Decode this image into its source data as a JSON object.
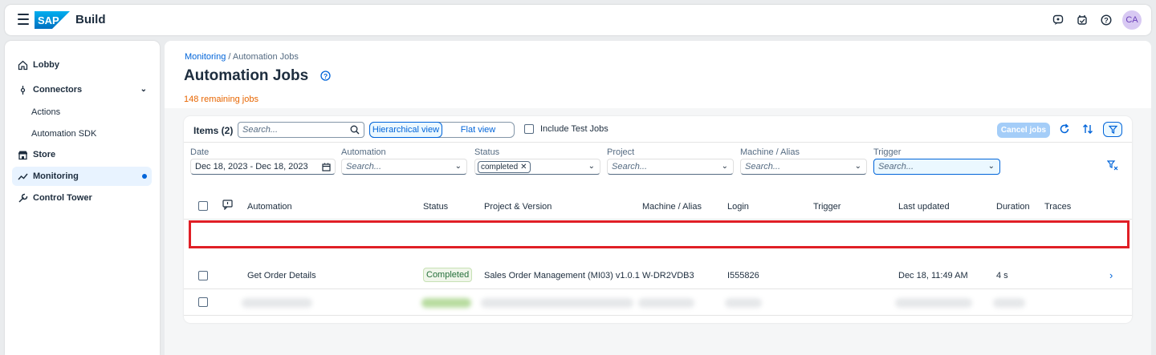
{
  "shell": {
    "product": "Build",
    "icons": [
      "joule-icon",
      "notifications-icon",
      "help-icon"
    ],
    "avatar": "CA"
  },
  "sidebar": {
    "items": [
      {
        "label": "Lobby",
        "icon": "home-icon"
      },
      {
        "label": "Connectors",
        "icon": "connector-icon"
      },
      {
        "label": "Actions"
      },
      {
        "label": "Automation SDK"
      },
      {
        "label": "Store",
        "icon": "store-icon"
      },
      {
        "label": "Monitoring",
        "icon": "monitoring-icon"
      },
      {
        "label": "Control Tower",
        "icon": "tools-icon"
      }
    ]
  },
  "page": {
    "breadcrumb_link": "Monitoring",
    "breadcrumb_current": " / Automation Jobs",
    "title": "Automation Jobs",
    "remaining": "148 remaining jobs"
  },
  "toolbar": {
    "items_label": "Items (2)",
    "search_placeholder": "Search...",
    "view_hierarchical": "Hierarchical view",
    "view_flat": "Flat view",
    "include_test": "Include Test Jobs",
    "cancel_jobs": "Cancel jobs"
  },
  "filters": {
    "date_label": "Date",
    "date_value": "Dec 18, 2023 - Dec 18, 2023",
    "automation_label": "Automation",
    "status_label": "Status",
    "status_token": "completed",
    "project_label": "Project",
    "machine_label": "Machine / Alias",
    "trigger_label": "Trigger",
    "placeholder": "Search..."
  },
  "table": {
    "columns": [
      "Automation",
      "Status",
      "Project & Version",
      "Machine / Alias",
      "Login",
      "Trigger",
      "Last updated",
      "Duration",
      "Traces"
    ],
    "rows": [
      {
        "automation": "Get Order Details",
        "status": "Completed",
        "project": "Sales Order Management (MI03) v1.0.1",
        "machine": "W-DR2VDB3",
        "login": "I555826",
        "trigger": "",
        "last_updated": "Dec 18, 11:49 AM",
        "duration": "4 s"
      }
    ]
  },
  "colors": {
    "accent": "#0064d9",
    "highlight": "#e01f26",
    "warning": "#e76500"
  }
}
